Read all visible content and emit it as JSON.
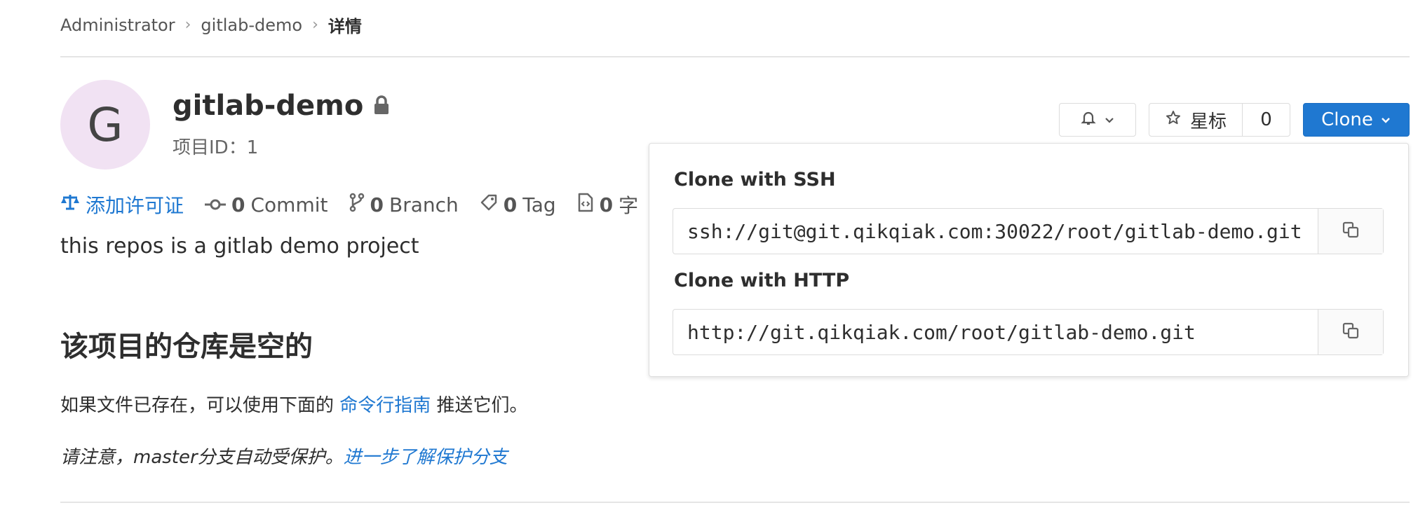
{
  "breadcrumb": {
    "items": [
      "Administrator",
      "gitlab-demo",
      "详情"
    ],
    "sep": "›"
  },
  "project": {
    "avatar_letter": "G",
    "name": "gitlab-demo",
    "id_label": "项目ID：1",
    "description": "this repos is a gitlab demo project"
  },
  "stats": {
    "license": "添加许可证",
    "commit_count": "0",
    "commit_label": "Commit",
    "branch_count": "0",
    "branch_label": "Branch",
    "tag_count": "0",
    "tag_label": "Tag",
    "files_count": "0",
    "files_label": "字"
  },
  "empty": {
    "heading": "该项目的仓库是空的",
    "line1_pre": "如果文件已存在，可以使用下面的 ",
    "line1_link": "命令行指南",
    "line1_post": " 推送它们。",
    "line2_pre": "请注意，master分支自动受保护。",
    "line2_link": "进一步了解保护分支"
  },
  "header_buttons": {
    "star_label": "星标",
    "star_count": "0",
    "clone_label": "Clone"
  },
  "clone_dropdown": {
    "ssh_label": "Clone with SSH",
    "ssh_url": "ssh://git@git.qikqiak.com:30022/root/gitlab-demo.git",
    "http_label": "Clone with HTTP",
    "http_url": "http://git.qikqiak.com/root/gitlab-demo.git"
  },
  "colors": {
    "accent": "#1f78d1",
    "avatar_bg": "#f1e2f3"
  }
}
